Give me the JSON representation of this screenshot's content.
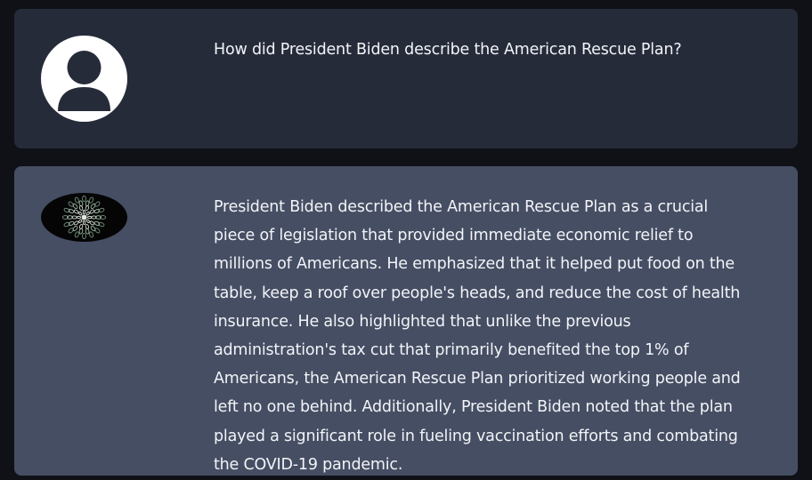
{
  "conversation": {
    "messages": [
      {
        "role": "user",
        "avatar_icon": "user-silhouette-icon",
        "text": "How did President Biden describe the American Rescue Plan?"
      },
      {
        "role": "assistant",
        "avatar_icon": "mandala-icon",
        "text": "President Biden described the American Rescue Plan as a crucial piece of legislation that provided immediate economic relief to millions of Americans. He emphasized that it helped put food on the table, keep a roof over people's heads, and reduce the cost of health insurance. He also highlighted that unlike the previous administration's tax cut that primarily benefited the top 1% of Americans, the American Rescue Plan prioritized working people and left no one behind. Additionally, President Biden noted that the plan played a significant role in fueling vaccination efforts and combating the COVID-19 pandemic."
      }
    ]
  },
  "colors": {
    "page_background": "#0f1117",
    "user_message_background": "#262b3a",
    "assistant_message_background": "#464e63",
    "text": "#f2f4f8"
  }
}
